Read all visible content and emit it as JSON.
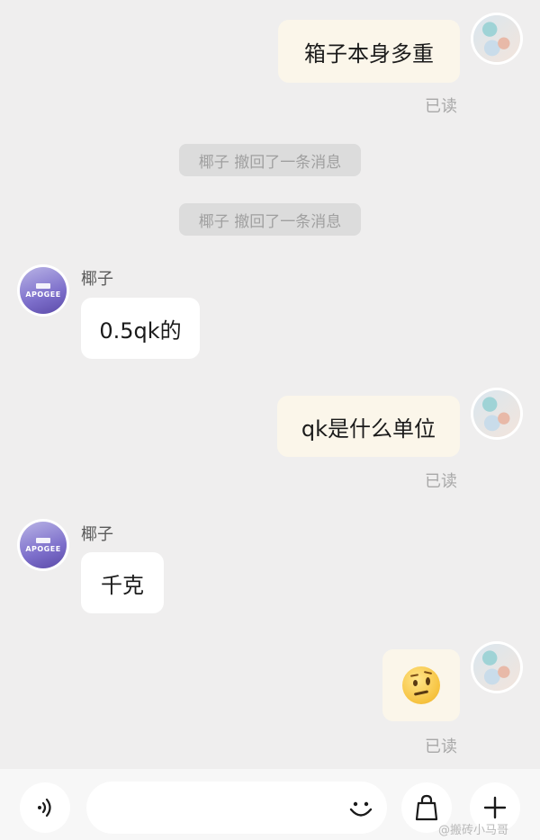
{
  "messages": [
    {
      "type": "outgoing",
      "text": "箱子本身多重",
      "status": "已读"
    },
    {
      "type": "recall",
      "text": "椰子 撤回了一条消息"
    },
    {
      "type": "recall",
      "text": "椰子 撤回了一条消息"
    },
    {
      "type": "incoming",
      "sender": "椰子",
      "text": "0.5qk的"
    },
    {
      "type": "outgoing",
      "text": "qk是什么单位",
      "status": "已读"
    },
    {
      "type": "incoming",
      "sender": "椰子",
      "text": "千克"
    },
    {
      "type": "outgoing",
      "emoji": "face-with-uneven-eyes-emoji",
      "status": "已读"
    }
  ],
  "friend_avatar_text": "APOGEE",
  "input": {
    "placeholder": "",
    "value": ""
  },
  "toolbar": {
    "voice_icon": "voice-icon",
    "emoji_icon": "smile-icon",
    "gift_icon": "gift-bag-icon",
    "more_icon": "plus-icon"
  },
  "watermark": "@搬砖小马哥"
}
